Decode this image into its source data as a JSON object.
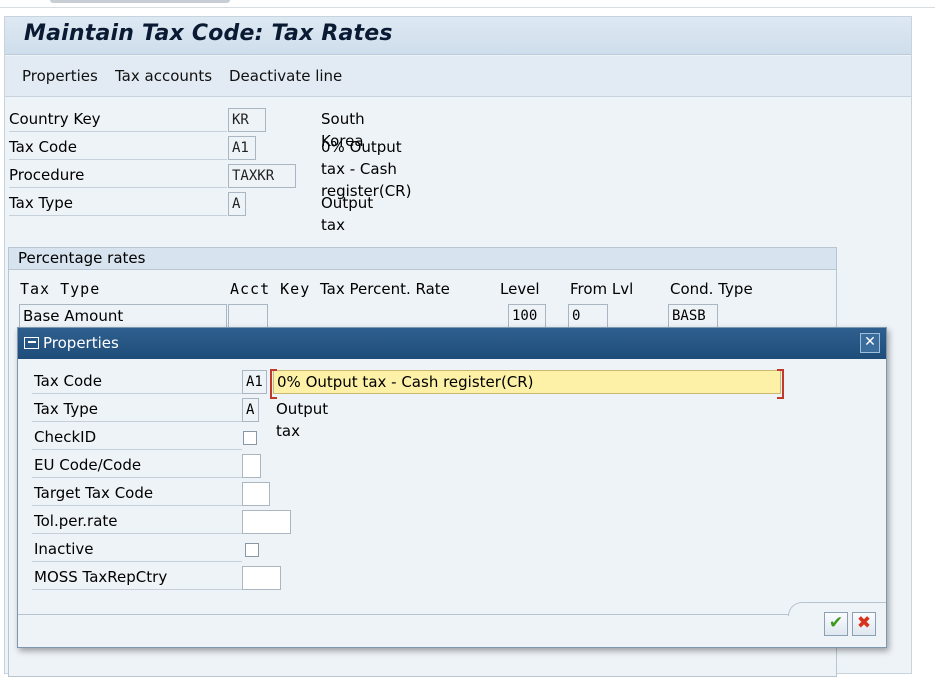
{
  "title": "Maintain Tax Code: Tax Rates",
  "menu": [
    "Properties",
    "Tax accounts",
    "Deactivate line"
  ],
  "header_fields": [
    {
      "label": "Country Key",
      "value": "KR",
      "desc": "South Korea"
    },
    {
      "label": "Tax Code",
      "value": "A1",
      "desc": "0% Output tax - Cash register(CR)"
    },
    {
      "label": "Procedure",
      "value": "TAXKR",
      "desc": ""
    },
    {
      "label": "Tax Type",
      "value": "A",
      "desc": "Output tax"
    }
  ],
  "rates": {
    "title": "Percentage rates",
    "columns": [
      "Tax Type",
      "Acct Key",
      "Tax Percent. Rate",
      "Level",
      "From Lvl",
      "Cond. Type"
    ],
    "rows": [
      {
        "tax_type": "Base Amount",
        "acct_key": "",
        "rate": "",
        "level": "100",
        "from_lvl": "0",
        "cond_type": "BASB"
      }
    ]
  },
  "dialog": {
    "title": "Properties",
    "tax_code": {
      "label": "Tax Code",
      "value": "A1",
      "desc": "0% Output tax - Cash register(CR)"
    },
    "tax_type": {
      "label": "Tax Type",
      "value": "A",
      "desc": "Output tax"
    },
    "check_id": {
      "label": "CheckID",
      "checked": false
    },
    "eu_code": {
      "label": "EU Code/Code",
      "value": ""
    },
    "target_tax_code": {
      "label": "Target Tax Code",
      "value": ""
    },
    "tol_per_rate": {
      "label": "Tol.per.rate",
      "value": ""
    },
    "inactive": {
      "label": "Inactive",
      "checked": false
    },
    "moss": {
      "label": "MOSS TaxRepCtry",
      "value": ""
    },
    "ok_icon": "checkmark-icon",
    "cancel_icon": "cancel-icon"
  }
}
